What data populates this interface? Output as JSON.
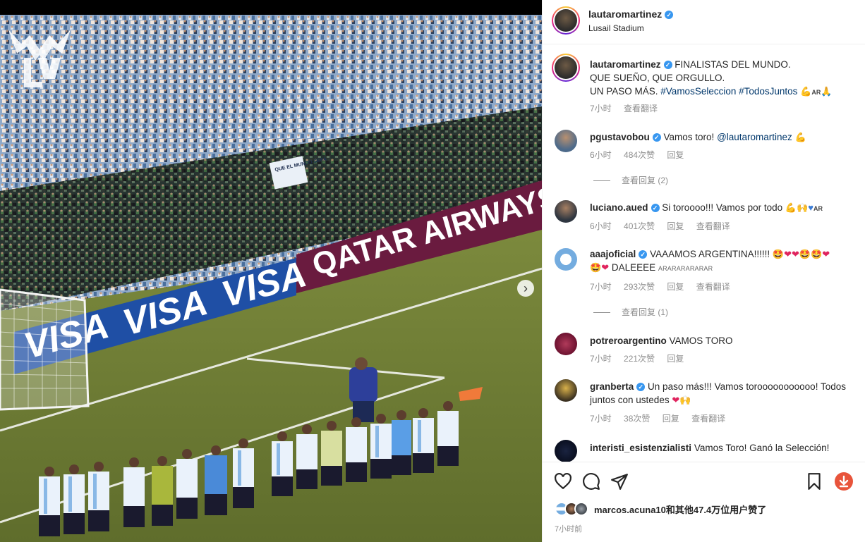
{
  "post": {
    "username": "lautaromartinez",
    "location": "Lusail Stadium",
    "caption_line1": "FINALISTAS DEL MUNDO.",
    "caption_line2": "QUE SUEÑO, QUE ORGULLO.",
    "caption_line3": "UN PASO MÁS.",
    "hashtag1": "#VamosSeleccion",
    "hashtag2": "#TodosJuntos",
    "caption_time": "7小时",
    "caption_translate": "查看翻译"
  },
  "photo": {
    "banner1": "QATAR AIRWAYS",
    "banner2": "VISA",
    "banner3": "VISA",
    "banner4": "VISA",
    "sign": "QUE EL MUNDO SEPA"
  },
  "comments": [
    {
      "user": "pgustavobou",
      "text": "Vamos toro!",
      "mention": "@lautaromartinez",
      "time": "6小时",
      "likes": "484次赞",
      "reply": "回复",
      "view_replies": "查看回复 (2)"
    },
    {
      "user": "luciano.aued",
      "text": "Si toroooo!!! Vamos por todo",
      "time": "6小时",
      "likes": "401次赞",
      "reply": "回复",
      "translate": "查看翻译"
    },
    {
      "user": "aaajoficial",
      "text": "VAAAMOS ARGENTINA!!!!!!",
      "text2": "DALEEEE",
      "text2_art": "ARARARARARAR",
      "time": "7小时",
      "likes": "293次赞",
      "reply": "回复",
      "translate": "查看翻译",
      "view_replies": "查看回复 (1)"
    },
    {
      "user": "potreroargentino",
      "text": "VAMOS TORO",
      "time": "7小时",
      "likes": "221次赞",
      "reply": "回复"
    },
    {
      "user": "granberta",
      "text": "Un paso más!!! Vamos torooooooooooo! Todos juntos con ustedes",
      "time": "7小时",
      "likes": "38次赞",
      "reply": "回复",
      "translate": "查看翻译"
    },
    {
      "user": "interisti_esistenzialisti",
      "text": "Vamos Toro! Ganó la Selección!"
    }
  ],
  "likes_summary": {
    "user": "marcos.acuna10",
    "text": "和其他47.4万位用户赞了",
    "time": "7小时前"
  },
  "colors": {
    "verified": "#3897f0",
    "link": "#00376b",
    "muted": "#8e8e8e",
    "download": "#e8543b"
  }
}
